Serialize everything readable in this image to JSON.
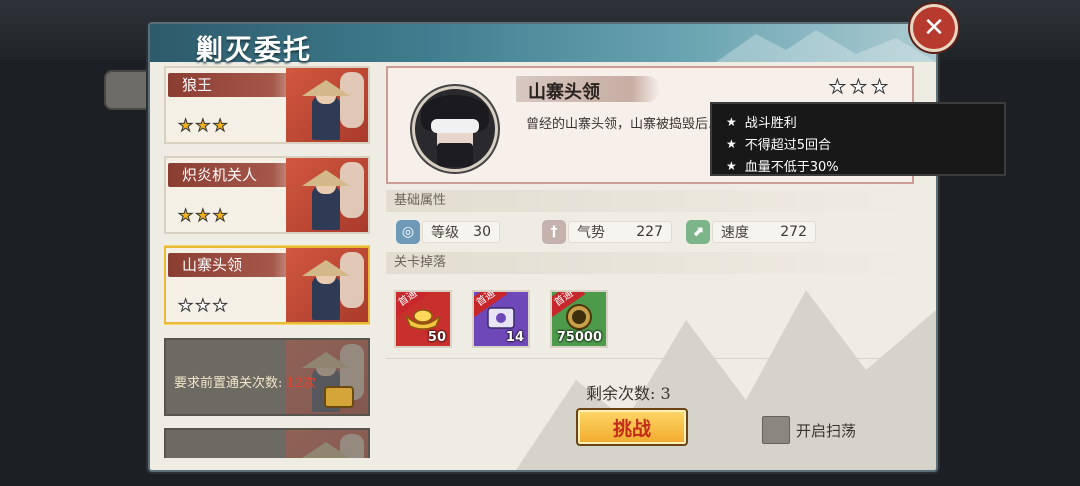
{
  "title": "剿灭委托",
  "close_icon": "close-icon",
  "missions": [
    {
      "name": "狼王",
      "stars": [
        true,
        true,
        true
      ],
      "selected": false
    },
    {
      "name": "炽炎机关人",
      "stars": [
        true,
        true,
        true
      ],
      "selected": false
    },
    {
      "name": "山寨头领",
      "stars": [
        false,
        false,
        false
      ],
      "selected": true
    }
  ],
  "locked_mission": {
    "text": "要求前置通关次数:",
    "count": "12次"
  },
  "boss": {
    "name": "山寨头领",
    "stars": [
      false,
      false,
      false
    ],
    "description": "曾经的山寨头领，山寨被捣毁后…四处劫掠，需要立即缉拿"
  },
  "tooltip": {
    "conditions": [
      "战斗胜利",
      "不得超过5回合",
      "血量不低于30%"
    ]
  },
  "attributes": {
    "label": "基础属性",
    "level": {
      "label": "等级",
      "value": "30",
      "icon": "level-icon"
    },
    "momentum": {
      "label": "气势",
      "value": "227",
      "icon": "sword-icon"
    },
    "speed": {
      "label": "速度",
      "value": "272",
      "icon": "boot-icon"
    }
  },
  "drops": {
    "label": "关卡掉落",
    "items": [
      {
        "name": "gold-ingot",
        "count": "50",
        "tag": "首通",
        "color": "#c7302c"
      },
      {
        "name": "scroll",
        "count": "14",
        "tag": "首通",
        "color": "#6e48b8"
      },
      {
        "name": "cultivation-coin",
        "count": "75000",
        "tag": "首通",
        "color": "#4d9a4a"
      }
    ]
  },
  "remaining": "剩余次数: 3",
  "challenge_label": "挑战",
  "sweep_label": "开启扫荡"
}
